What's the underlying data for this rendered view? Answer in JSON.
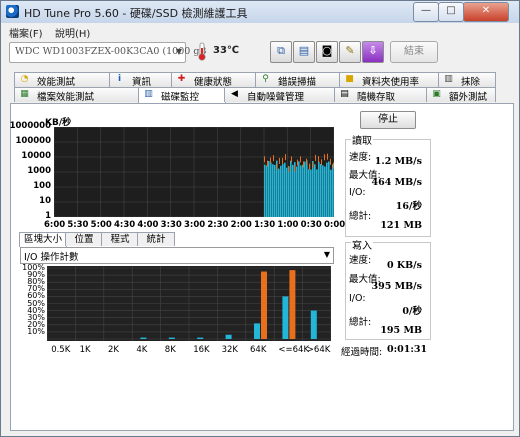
{
  "window": {
    "title": "HD Tune Pro 5.60 - 硬碟/SSD 檢測維護工具",
    "minimize": "—",
    "maximize": "□",
    "close": "✕"
  },
  "menu": [
    "檔案(F)",
    "說明(H)"
  ],
  "toolbar": {
    "drive": "WDC WD1003FZEX-00K3CA0 (1000 gB",
    "temperature": "33℃",
    "exit_label": "結束"
  },
  "tabs_row1": [
    {
      "label": "效能測試",
      "icon": "benchmark-icon"
    },
    {
      "label": "資訊",
      "icon": "info-icon"
    },
    {
      "label": "健康狀態",
      "icon": "health-icon"
    },
    {
      "label": "錯誤掃描",
      "icon": "magnifier-icon"
    },
    {
      "label": "資料夾使用率",
      "icon": "folder-icon"
    },
    {
      "label": "抹除",
      "icon": "erase-icon"
    }
  ],
  "tabs_row2": [
    {
      "label": "檔案效能測試",
      "icon": "file-benchmark-icon"
    },
    {
      "label": "磁碟監控",
      "icon": "disk-monitor-icon",
      "active": true
    },
    {
      "label": "自動噪聲管理",
      "icon": "speaker-icon"
    },
    {
      "label": "隨機存取",
      "icon": "random-access-icon"
    },
    {
      "label": "額外測試",
      "icon": "extra-tests-icon"
    }
  ],
  "monitor": {
    "unit": "KB/秒",
    "stop_label": "停止",
    "y_ticks": [
      "1000000",
      "100000",
      "10000",
      "1000",
      "100",
      "10",
      "1"
    ],
    "x_ticks": [
      "6:00",
      "5:30",
      "5:00",
      "4:30",
      "4:00",
      "3:30",
      "3:00",
      "2:30",
      "2:00",
      "1:30",
      "1:00",
      "0:30",
      "0:00"
    ]
  },
  "read": {
    "title": "讀取",
    "speed_label": "速度:",
    "speed": "1.2 MB/s",
    "max_label": "最大值:",
    "max": "464 MB/s",
    "io_label": "I/O:",
    "io": "16/秒",
    "total_label": "總計:",
    "total": "121 MB"
  },
  "write": {
    "title": "寫入",
    "speed_label": "速度:",
    "speed": "0 KB/s",
    "max_label": "最大值:",
    "max": "395 MB/s",
    "io_label": "I/O:",
    "io": "0/秒",
    "total_label": "總計:",
    "total": "195 MB"
  },
  "elapsed": {
    "label": "經過時間:",
    "value": "0:01:31"
  },
  "subtabs": [
    "區塊大小",
    "位置",
    "程式",
    "統計"
  ],
  "io_combo": "I/O 操作計數",
  "colors": {
    "read": "#23b6d8",
    "write": "#e8701c",
    "plot_bg": "#1e1e1e",
    "grid": "#444444"
  },
  "chart_data": [
    {
      "type": "area",
      "title": "",
      "ylabel": "KB/秒",
      "yscale": "log",
      "ylim": [
        1,
        1000000
      ],
      "x_labels": [
        "6:00",
        "5:30",
        "5:00",
        "4:30",
        "4:00",
        "3:30",
        "3:00",
        "2:30",
        "2:00",
        "1:30",
        "1:00",
        "0:30",
        "0:00"
      ],
      "series": [
        {
          "name": "讀取",
          "activity_window_minutes": [
            1.5,
            0.0
          ],
          "typical_kb_s": 3000
        },
        {
          "name": "寫入",
          "activity_window_minutes": [
            1.5,
            0.0
          ],
          "typical_kb_s": 10000
        }
      ]
    },
    {
      "type": "bar",
      "title": "",
      "categories": [
        "0.5K",
        "1K",
        "2K",
        "4K",
        "8K",
        "16K",
        "32K",
        "64K",
        "<=64K",
        ">64K"
      ],
      "ylim": [
        0,
        100
      ],
      "y_ticks": [
        "100%",
        "90%",
        "80%",
        "70%",
        "60%",
        "50%",
        "40%",
        "30%",
        "20%",
        "10%"
      ],
      "series": [
        {
          "name": "讀取",
          "values": [
            0,
            0,
            0,
            2,
            2,
            2,
            6,
            22,
            60,
            40
          ]
        },
        {
          "name": "寫入",
          "values": [
            0,
            0,
            0,
            0,
            0,
            0,
            0,
            95,
            97,
            0
          ]
        }
      ]
    }
  ]
}
